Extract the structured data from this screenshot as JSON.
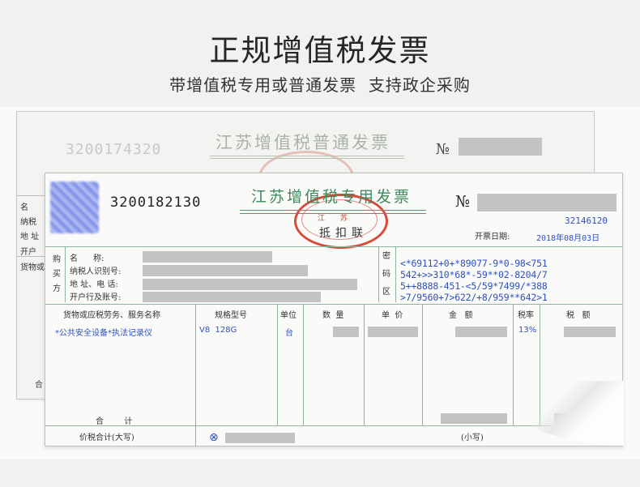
{
  "header": {
    "title": "正规增值税发票",
    "subtitle": "带增值税专用或普通发票  支持政企采购"
  },
  "back_invoice": {
    "invoice_number": "3200174320",
    "title": "江苏增值税普通发票",
    "no_sign": "№",
    "labels": [
      "名",
      "纳税",
      "地 址",
      "开户"
    ],
    "goods_label": "货物或",
    "sum_label": "合"
  },
  "front_invoice": {
    "invoice_number": "3200182130",
    "title": "江苏增值税专用发票",
    "copy_name": "抵扣联",
    "no_sign": "№",
    "invoice_code": "32146120",
    "issue_date_label": "开票日期:",
    "issue_date": "2018年08月03日",
    "stamp_text": "江 苏",
    "buyer_side_label": [
      "购",
      "买",
      "方"
    ],
    "buyer_fields": [
      "名      称:",
      "纳税人识别号:",
      "地 址、电 话:",
      "开户行及账号:"
    ],
    "cipher_side_label": [
      "密",
      "码",
      "区"
    ],
    "cipher_lines": [
      "<*69112+0+*89077-9*0-98<751",
      "542+>>310*68*-59**02-8204/7",
      "5++8888-451-<5/59*7499/*388",
      ">7/9560+7>622/+8/959**642>1"
    ],
    "columns": [
      "货物或应税劳务、服务名称",
      "规格型号",
      "单位",
      "数  量",
      "单  价",
      "金   额",
      "税率",
      "税   额"
    ],
    "row": {
      "name": "*公共安全设备*执法记录仪",
      "spec": "V8  128G",
      "unit": "台",
      "tax_rate": "13%"
    },
    "total_label": "合        计",
    "total_in_words_label": "价税合计(大写)",
    "in_figures_label": "(小写)"
  }
}
